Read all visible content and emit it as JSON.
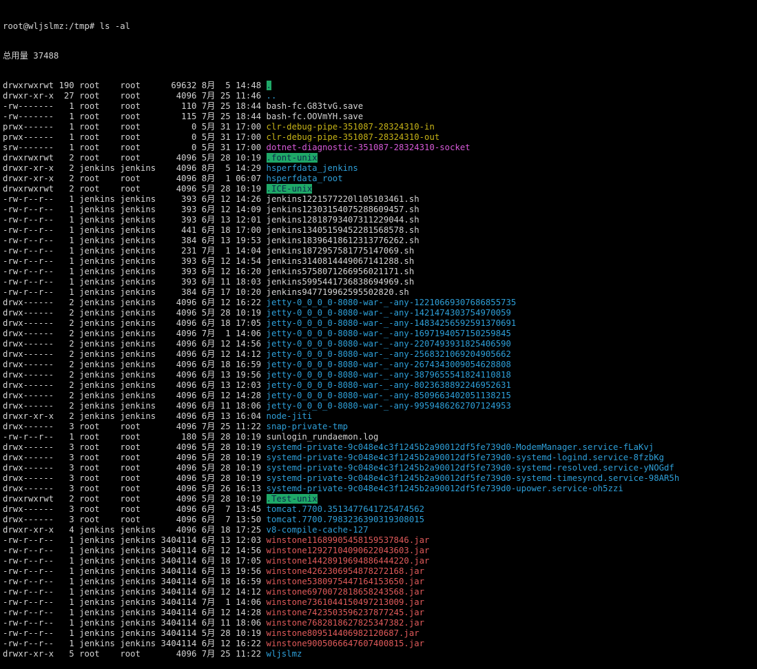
{
  "prompt": "root@wljslmz:/tmp# ls -al",
  "total": "总用量 37488",
  "colors": {
    "background": "#000000",
    "text": "#d4d4d4",
    "dir": "#2e9fd8",
    "sticky_bg": "#1fa968",
    "sticky_fg": "#0d2a4a",
    "pipe": "#c6b317",
    "socket": "#d65ad8",
    "archive": "#e05a5a"
  },
  "entries": [
    {
      "perm": "drwxrwxrwt",
      "links": "190",
      "owner": "root",
      "group": "root",
      "size": "69632",
      "month": "8月",
      "day": "5",
      "time": "14:48",
      "name": ".",
      "type": "sticky"
    },
    {
      "perm": "drwxr-xr-x",
      "links": "27",
      "owner": "root",
      "group": "root",
      "size": "4096",
      "month": "7月",
      "day": "25",
      "time": "11:46",
      "name": "..",
      "type": "dir"
    },
    {
      "perm": "-rw-------",
      "links": "1",
      "owner": "root",
      "group": "root",
      "size": "110",
      "month": "7月",
      "day": "25",
      "time": "18:44",
      "name": "bash-fc.G83tvG.save",
      "type": "plain"
    },
    {
      "perm": "-rw-------",
      "links": "1",
      "owner": "root",
      "group": "root",
      "size": "115",
      "month": "7月",
      "day": "25",
      "time": "18:44",
      "name": "bash-fc.OOVmYH.save",
      "type": "plain"
    },
    {
      "perm": "prwx------",
      "links": "1",
      "owner": "root",
      "group": "root",
      "size": "0",
      "month": "5月",
      "day": "31",
      "time": "17:00",
      "name": "clr-debug-pipe-351087-28324310-in",
      "type": "pipe"
    },
    {
      "perm": "prwx------",
      "links": "1",
      "owner": "root",
      "group": "root",
      "size": "0",
      "month": "5月",
      "day": "31",
      "time": "17:00",
      "name": "clr-debug-pipe-351087-28324310-out",
      "type": "pipe"
    },
    {
      "perm": "srw-------",
      "links": "1",
      "owner": "root",
      "group": "root",
      "size": "0",
      "month": "5月",
      "day": "31",
      "time": "17:00",
      "name": "dotnet-diagnostic-351087-28324310-socket",
      "type": "socket"
    },
    {
      "perm": "drwxrwxrwt",
      "links": "2",
      "owner": "root",
      "group": "root",
      "size": "4096",
      "month": "5月",
      "day": "28",
      "time": "10:19",
      "name": ".font-unix",
      "type": "sticky"
    },
    {
      "perm": "drwxr-xr-x",
      "links": "2",
      "owner": "jenkins",
      "group": "jenkins",
      "size": "4096",
      "month": "8月",
      "day": "5",
      "time": "14:29",
      "name": "hsperfdata_jenkins",
      "type": "dir"
    },
    {
      "perm": "drwxr-xr-x",
      "links": "2",
      "owner": "root",
      "group": "root",
      "size": "4096",
      "month": "8月",
      "day": "1",
      "time": "06:07",
      "name": "hsperfdata_root",
      "type": "dir"
    },
    {
      "perm": "drwxrwxrwt",
      "links": "2",
      "owner": "root",
      "group": "root",
      "size": "4096",
      "month": "5月",
      "day": "28",
      "time": "10:19",
      "name": ".ICE-unix",
      "type": "sticky"
    },
    {
      "perm": "-rw-r--r--",
      "links": "1",
      "owner": "jenkins",
      "group": "jenkins",
      "size": "393",
      "month": "6月",
      "day": "12",
      "time": "14:26",
      "name": "jenkins1221577220l105103461.sh",
      "type": "plain"
    },
    {
      "perm": "-rw-r--r--",
      "links": "1",
      "owner": "jenkins",
      "group": "jenkins",
      "size": "393",
      "month": "6月",
      "day": "12",
      "time": "14:09",
      "name": "jenkins12303154075288609457.sh",
      "type": "plain"
    },
    {
      "perm": "-rw-r--r--",
      "links": "1",
      "owner": "jenkins",
      "group": "jenkins",
      "size": "393",
      "month": "6月",
      "day": "13",
      "time": "12:01",
      "name": "jenkins12818793407311229044.sh",
      "type": "plain"
    },
    {
      "perm": "-rw-r--r--",
      "links": "1",
      "owner": "jenkins",
      "group": "jenkins",
      "size": "441",
      "month": "6月",
      "day": "18",
      "time": "17:00",
      "name": "jenkins13405159452281568578.sh",
      "type": "plain"
    },
    {
      "perm": "-rw-r--r--",
      "links": "1",
      "owner": "jenkins",
      "group": "jenkins",
      "size": "384",
      "month": "6月",
      "day": "13",
      "time": "19:53",
      "name": "jenkins18396418612313776262.sh",
      "type": "plain"
    },
    {
      "perm": "-rw-r--r--",
      "links": "1",
      "owner": "jenkins",
      "group": "jenkins",
      "size": "231",
      "month": "7月",
      "day": "1",
      "time": "14:04",
      "name": "jenkins1872957581775147069.sh",
      "type": "plain"
    },
    {
      "perm": "-rw-r--r--",
      "links": "1",
      "owner": "jenkins",
      "group": "jenkins",
      "size": "393",
      "month": "6月",
      "day": "12",
      "time": "14:54",
      "name": "jenkins3140814449067141288.sh",
      "type": "plain"
    },
    {
      "perm": "-rw-r--r--",
      "links": "1",
      "owner": "jenkins",
      "group": "jenkins",
      "size": "393",
      "month": "6月",
      "day": "12",
      "time": "16:20",
      "name": "jenkins5758071266956021171.sh",
      "type": "plain"
    },
    {
      "perm": "-rw-r--r--",
      "links": "1",
      "owner": "jenkins",
      "group": "jenkins",
      "size": "393",
      "month": "6月",
      "day": "11",
      "time": "18:03",
      "name": "jenkins5995441736838694969.sh",
      "type": "plain"
    },
    {
      "perm": "-rw-r--r--",
      "links": "1",
      "owner": "jenkins",
      "group": "jenkins",
      "size": "384",
      "month": "6月",
      "day": "17",
      "time": "10:20",
      "name": "jenkins947719962595502820.sh",
      "type": "plain"
    },
    {
      "perm": "drwx------",
      "links": "2",
      "owner": "jenkins",
      "group": "jenkins",
      "size": "4096",
      "month": "6月",
      "day": "12",
      "time": "16:22",
      "name": "jetty-0_0_0_0-8080-war-_-any-1221066930768685573​5",
      "type": "dir"
    },
    {
      "perm": "drwx------",
      "links": "2",
      "owner": "jenkins",
      "group": "jenkins",
      "size": "4096",
      "month": "5月",
      "day": "28",
      "time": "10:19",
      "name": "jetty-0_0_0_0-8080-war-_-any-1421474303754970059",
      "type": "dir"
    },
    {
      "perm": "drwx------",
      "links": "2",
      "owner": "jenkins",
      "group": "jenkins",
      "size": "4096",
      "month": "6月",
      "day": "18",
      "time": "17:05",
      "name": "jetty-0_0_0_0-8080-war-_-any-1483425659259137069​1",
      "type": "dir"
    },
    {
      "perm": "drwx------",
      "links": "2",
      "owner": "jenkins",
      "group": "jenkins",
      "size": "4096",
      "month": "7月",
      "day": "1",
      "time": "14:06",
      "name": "jetty-0_0_0_0-8080-war-_-any-1697194057150259845",
      "type": "dir"
    },
    {
      "perm": "drwx------",
      "links": "2",
      "owner": "jenkins",
      "group": "jenkins",
      "size": "4096",
      "month": "6月",
      "day": "12",
      "time": "14:56",
      "name": "jetty-0_0_0_0-8080-war-_-any-2207493931825406590",
      "type": "dir"
    },
    {
      "perm": "drwx------",
      "links": "2",
      "owner": "jenkins",
      "group": "jenkins",
      "size": "4096",
      "month": "6月",
      "day": "12",
      "time": "14:12",
      "name": "jetty-0_0_0_0-8080-war-_-any-2568321069204905662",
      "type": "dir"
    },
    {
      "perm": "drwx------",
      "links": "2",
      "owner": "jenkins",
      "group": "jenkins",
      "size": "4096",
      "month": "6月",
      "day": "18",
      "time": "16:59",
      "name": "jetty-0_0_0_0-8080-war-_-any-2674343009054628808",
      "type": "dir"
    },
    {
      "perm": "drwx------",
      "links": "2",
      "owner": "jenkins",
      "group": "jenkins",
      "size": "4096",
      "month": "6月",
      "day": "13",
      "time": "19:56",
      "name": "jetty-0_0_0_0-8080-war-_-any-3879655541824110818",
      "type": "dir"
    },
    {
      "perm": "drwx------",
      "links": "2",
      "owner": "jenkins",
      "group": "jenkins",
      "size": "4096",
      "month": "6月",
      "day": "13",
      "time": "12:03",
      "name": "jetty-0_0_0_0-8080-war-_-any-8023638892246952631",
      "type": "dir"
    },
    {
      "perm": "drwx------",
      "links": "2",
      "owner": "jenkins",
      "group": "jenkins",
      "size": "4096",
      "month": "6月",
      "day": "12",
      "time": "14:28",
      "name": "jetty-0_0_0_0-8080-war-_-any-8509663402051138215",
      "type": "dir"
    },
    {
      "perm": "drwx------",
      "links": "2",
      "owner": "jenkins",
      "group": "jenkins",
      "size": "4096",
      "month": "6月",
      "day": "11",
      "time": "18:06",
      "name": "jetty-0_0_0_0-8080-war-_-any-9959486262707124953",
      "type": "dir"
    },
    {
      "perm": "drwxr-xr-x",
      "links": "2",
      "owner": "jenkins",
      "group": "jenkins",
      "size": "4096",
      "month": "6月",
      "day": "13",
      "time": "16:04",
      "name": "node-jiti",
      "type": "dir"
    },
    {
      "perm": "drwx------",
      "links": "3",
      "owner": "root",
      "group": "root",
      "size": "4096",
      "month": "7月",
      "day": "25",
      "time": "11:22",
      "name": "snap-private-tmp",
      "type": "dir"
    },
    {
      "perm": "-rw-r--r--",
      "links": "1",
      "owner": "root",
      "group": "root",
      "size": "180",
      "month": "5月",
      "day": "28",
      "time": "10:19",
      "name": "sunlogin_rundaemon.log",
      "type": "plain"
    },
    {
      "perm": "drwx------",
      "links": "3",
      "owner": "root",
      "group": "root",
      "size": "4096",
      "month": "5月",
      "day": "28",
      "time": "10:19",
      "name": "systemd-private-9c048e4c3f1245b2a90012df5fe739d0-ModemManager.service-fLaKvj",
      "type": "dir"
    },
    {
      "perm": "drwx------",
      "links": "3",
      "owner": "root",
      "group": "root",
      "size": "4096",
      "month": "5月",
      "day": "28",
      "time": "10:19",
      "name": "systemd-private-9c048e4c3f1245b2a90012df5fe739d0-systemd-logind.service-8fzbKg",
      "type": "dir"
    },
    {
      "perm": "drwx------",
      "links": "3",
      "owner": "root",
      "group": "root",
      "size": "4096",
      "month": "5月",
      "day": "28",
      "time": "10:19",
      "name": "systemd-private-9c048e4c3f1245b2a90012df5fe739d0-systemd-resolved.service-yNOGdf",
      "type": "dir"
    },
    {
      "perm": "drwx------",
      "links": "3",
      "owner": "root",
      "group": "root",
      "size": "4096",
      "month": "5月",
      "day": "28",
      "time": "10:19",
      "name": "systemd-private-9c048e4c3f1245b2a90012df5fe739d0-systemd-timesyncd.service-98AR5h",
      "type": "dir"
    },
    {
      "perm": "drwx------",
      "links": "3",
      "owner": "root",
      "group": "root",
      "size": "4096",
      "month": "5月",
      "day": "26",
      "time": "16:13",
      "name": "systemd-private-9c048e4c3f1245b2a90012df5fe739d0-upower.service-oh5zzi",
      "type": "dir"
    },
    {
      "perm": "drwxrwxrwt",
      "links": "2",
      "owner": "root",
      "group": "root",
      "size": "4096",
      "month": "5月",
      "day": "28",
      "time": "10:19",
      "name": ".Test-unix",
      "type": "sticky"
    },
    {
      "perm": "drwx------",
      "links": "3",
      "owner": "root",
      "group": "root",
      "size": "4096",
      "month": "6月",
      "day": "7",
      "time": "13:45",
      "name": "tomcat.7700.3513477641725474562",
      "type": "dir"
    },
    {
      "perm": "drwx------",
      "links": "3",
      "owner": "root",
      "group": "root",
      "size": "4096",
      "month": "6月",
      "day": "7",
      "time": "13:50",
      "name": "tomcat.7700.7983236390319308015",
      "type": "dir"
    },
    {
      "perm": "drwxr-xr-x",
      "links": "4",
      "owner": "jenkins",
      "group": "jenkins",
      "size": "4096",
      "month": "6月",
      "day": "18",
      "time": "17:25",
      "name": "v8-compile-cache-127",
      "type": "dir"
    },
    {
      "perm": "-rw-r--r--",
      "links": "1",
      "owner": "jenkins",
      "group": "jenkins",
      "size": "3404114",
      "month": "6月",
      "day": "13",
      "time": "12:03",
      "name": "winstone11689905458159537846.jar",
      "type": "archive"
    },
    {
      "perm": "-rw-r--r--",
      "links": "1",
      "owner": "jenkins",
      "group": "jenkins",
      "size": "3404114",
      "month": "6月",
      "day": "12",
      "time": "14:56",
      "name": "winstone12927104090622043603.jar",
      "type": "archive"
    },
    {
      "perm": "-rw-r--r--",
      "links": "1",
      "owner": "jenkins",
      "group": "jenkins",
      "size": "3404114",
      "month": "6月",
      "day": "18",
      "time": "17:05",
      "name": "winstone14428919694886444220.jar",
      "type": "archive"
    },
    {
      "perm": "-rw-r--r--",
      "links": "1",
      "owner": "jenkins",
      "group": "jenkins",
      "size": "3404114",
      "month": "6月",
      "day": "13",
      "time": "19:56",
      "name": "winstone4262306954878272168.jar",
      "type": "archive"
    },
    {
      "perm": "-rw-r--r--",
      "links": "1",
      "owner": "jenkins",
      "group": "jenkins",
      "size": "3404114",
      "month": "6月",
      "day": "18",
      "time": "16:59",
      "name": "winstone5380975447164153650.jar",
      "type": "archive"
    },
    {
      "perm": "-rw-r--r--",
      "links": "1",
      "owner": "jenkins",
      "group": "jenkins",
      "size": "3404114",
      "month": "6月",
      "day": "12",
      "time": "14:12",
      "name": "winstone6970072818658243568.jar",
      "type": "archive"
    },
    {
      "perm": "-rw-r--r--",
      "links": "1",
      "owner": "jenkins",
      "group": "jenkins",
      "size": "3404114",
      "month": "7月",
      "day": "1",
      "time": "14:06",
      "name": "winstone7361044150497213009.jar",
      "type": "archive"
    },
    {
      "perm": "-rw-r--r--",
      "links": "1",
      "owner": "jenkins",
      "group": "jenkins",
      "size": "3404114",
      "month": "6月",
      "day": "12",
      "time": "14:28",
      "name": "winstone7423503596237877245.jar",
      "type": "archive"
    },
    {
      "perm": "-rw-r--r--",
      "links": "1",
      "owner": "jenkins",
      "group": "jenkins",
      "size": "3404114",
      "month": "6月",
      "day": "11",
      "time": "18:06",
      "name": "winstone7682818627825347382.jar",
      "type": "archive"
    },
    {
      "perm": "-rw-r--r--",
      "links": "1",
      "owner": "jenkins",
      "group": "jenkins",
      "size": "3404114",
      "month": "5月",
      "day": "28",
      "time": "10:19",
      "name": "winstone809514406982120687.jar",
      "type": "archive"
    },
    {
      "perm": "-rw-r--r--",
      "links": "1",
      "owner": "jenkins",
      "group": "jenkins",
      "size": "3404114",
      "month": "6月",
      "day": "12",
      "time": "16:22",
      "name": "winstone9005066647607400815.jar",
      "type": "archive"
    },
    {
      "perm": "drwxr-xr-x",
      "links": "5",
      "owner": "root",
      "group": "root",
      "size": "4096",
      "month": "7月",
      "day": "25",
      "time": "11:22",
      "name": "wljslmz",
      "type": "dir"
    }
  ]
}
